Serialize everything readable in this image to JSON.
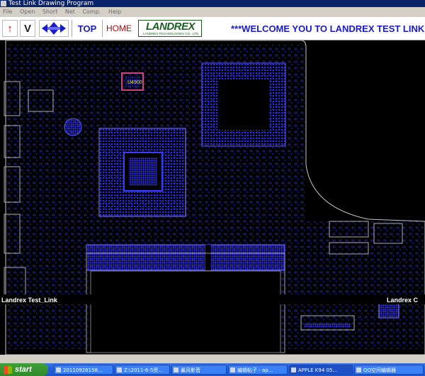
{
  "window": {
    "title": "Test Link Drawing Program"
  },
  "menu": {
    "items": [
      "File",
      "Open",
      "Short",
      "Net",
      "Comp.",
      "Help"
    ]
  },
  "toolbar": {
    "up_arrow": "↑",
    "v_label": "V",
    "top_label": "TOP",
    "home_label": "HOME",
    "logo_text": "LANDREX",
    "logo_subtext": "LANDREX TECHNOLOGIES CO., LTD.",
    "welcome": "***WELCOME YOU TO LANDREX TEST LINK"
  },
  "board": {
    "highlight_component": "U4900",
    "overlay_left": "Landrex Test_Link",
    "overlay_right": "Landrex C"
  },
  "taskbar": {
    "start_label": "start",
    "tasks": [
      "20110928158...",
      "Z:\\2011-6-5资...",
      "暴风影音",
      "编辑帖子 - ap...",
      "APPLE K94 05...",
      "QQ空间编辑器"
    ]
  },
  "colors": {
    "board_outline": "#3a3acc",
    "pad": "#2a2aff",
    "highlight": "#d04080",
    "welcome": "#1a1acd",
    "top": "#1a1acd",
    "home": "#cc0000"
  }
}
